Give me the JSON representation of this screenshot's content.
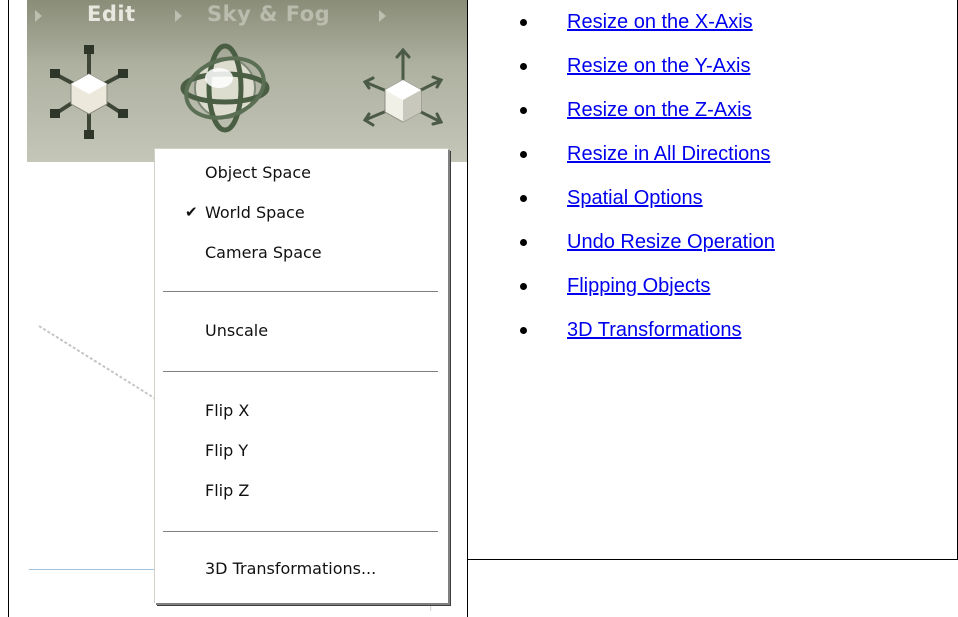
{
  "toolbar": {
    "tabs": [
      {
        "label": "Edit"
      },
      {
        "label": "Sky & Fog"
      }
    ],
    "icons": [
      "scale-cube-icon",
      "rotate-sphere-icon",
      "move-cube-icon"
    ]
  },
  "context_menu": {
    "sections": [
      [
        {
          "label": "Object Space",
          "checked": false
        },
        {
          "label": "World Space",
          "checked": true
        },
        {
          "label": "Camera Space",
          "checked": false
        }
      ],
      [
        {
          "label": "Unscale"
        }
      ],
      [
        {
          "label": "Flip X"
        },
        {
          "label": "Flip Y"
        },
        {
          "label": "Flip Z"
        }
      ],
      [
        {
          "label": "3D Transformations..."
        }
      ]
    ],
    "check_mark": "✔"
  },
  "links": [
    "Resize on the X-Axis",
    "Resize on the Y-Axis",
    "Resize on the Z-Axis",
    "Resize in All Directions",
    "Spatial Options",
    "Undo Resize Operation",
    "Flipping Objects",
    "3D Transformations"
  ],
  "colors": {
    "link": "#0000ee",
    "panel": "#aeb0a0",
    "menu_background": "#ffffff"
  }
}
